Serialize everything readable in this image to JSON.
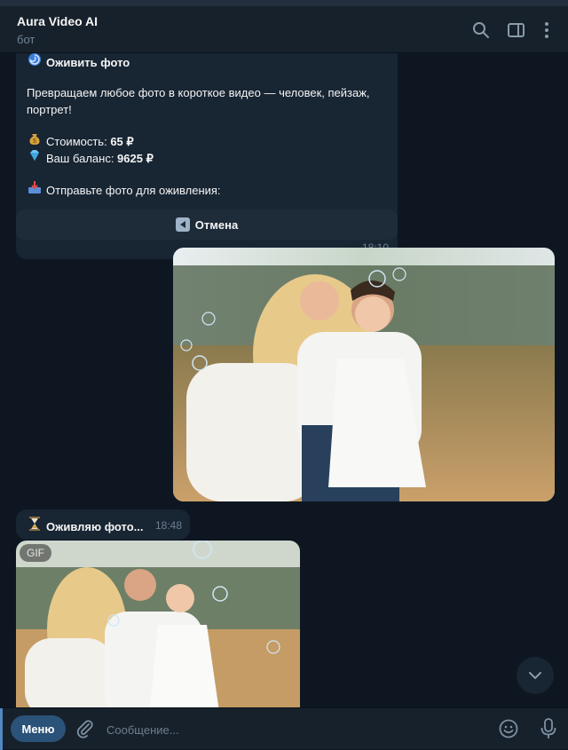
{
  "header": {
    "title": "Aura Video AI",
    "subtitle": "бот",
    "icons": [
      "search-icon",
      "sidebar-toggle-icon",
      "more-vertical-icon"
    ]
  },
  "messages": {
    "intro": {
      "title_icon": "cyclone-emoji",
      "title": "Оживить фото",
      "description": "Превращаем любое фото в короткое видео — человек, пейзаж, портрет!",
      "cost_icon": "money-bag-emoji",
      "cost_label": "Стоимость: ",
      "cost_value": "65 ₽",
      "balance_icon": "gem-emoji",
      "balance_label": "Ваш баланс: ",
      "balance_value": "9625 ₽",
      "prompt_icon": "inbox-tray-emoji",
      "prompt": "Отправьте фото для оживления:",
      "time": "18:10"
    },
    "cancel_button": {
      "icon": "back-arrow-icon",
      "label": "Отмена"
    },
    "status": {
      "icon": "hourglass-emoji",
      "text": "Оживляю фото...",
      "time": "18:48"
    },
    "gif": {
      "badge": "GIF"
    }
  },
  "composer": {
    "menu_label": "Меню",
    "placeholder": "Сообщение..."
  },
  "colors": {
    "background": "#0e1621",
    "header": "#17212b",
    "bubble_incoming": "#182533",
    "menu_button": "#2b5278",
    "accent": "#5288c1",
    "muted_text": "#708499"
  }
}
